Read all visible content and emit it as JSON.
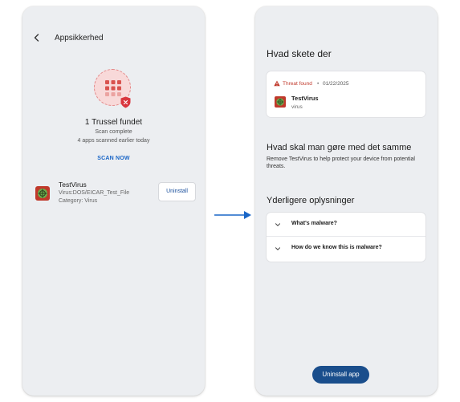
{
  "colors": {
    "accent_blue": "#1a66c7",
    "primary_button": "#1a4e8c",
    "threat_red": "#c0392b",
    "hero_pink": "#f8d9d9",
    "panel_bg": "#eceef1"
  },
  "left_screen": {
    "header": {
      "back_icon": "chevron-left-icon",
      "title": "Appsikkerhed"
    },
    "status": {
      "title": "1 Trussel fundet",
      "line1": "Scan complete",
      "line2": "4 apps scanned earlier today",
      "scan_now": "SCAN NOW"
    },
    "threat_item": {
      "name": "TestVirus",
      "path": "Virus:DOS/EICAR_Test_File",
      "category": "Category: Virus",
      "action": "Uninstall"
    }
  },
  "right_screen": {
    "what_happened": {
      "heading": "Hvad skete der",
      "status": "Threat found",
      "separator": "•",
      "date": "01/22/2025",
      "app_name": "TestVirus",
      "app_type": "virus"
    },
    "what_now": {
      "heading": "Hvad skal man gøre med det samme",
      "description": "Remove TestVirus to help protect your device from potential threats."
    },
    "more_info": {
      "heading": "Yderligere oplysninger",
      "items": [
        {
          "label": "What's malware?"
        },
        {
          "label": "How do we know this is malware?"
        }
      ]
    },
    "primary_action": "Uninstall app"
  }
}
